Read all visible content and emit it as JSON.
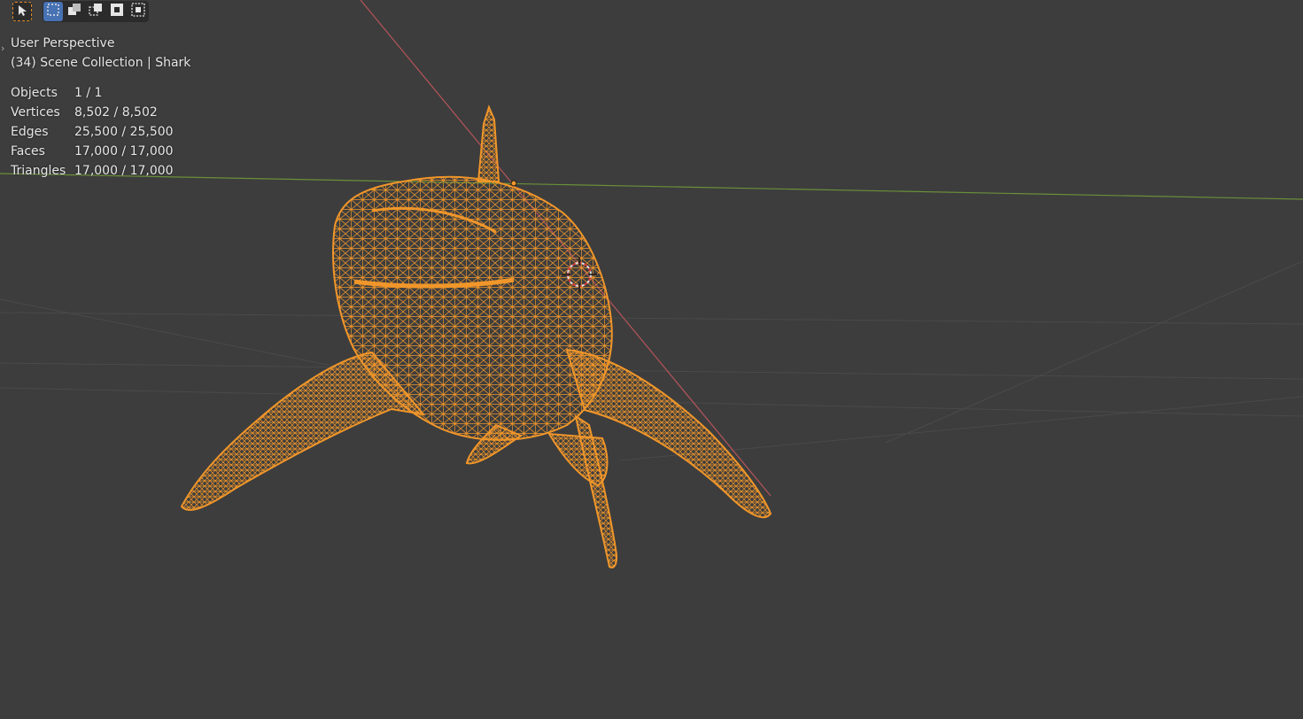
{
  "viewport": {
    "view_name": "User Perspective",
    "collection_path": "(34) Scene Collection | Shark",
    "stats": [
      {
        "label": "Objects",
        "value": "1 / 1"
      },
      {
        "label": "Vertices",
        "value": "8,502 / 8,502"
      },
      {
        "label": "Edges",
        "value": "25,500 / 25,500"
      },
      {
        "label": "Faces",
        "value": "17,000 / 17,000"
      },
      {
        "label": "Triangles",
        "value": "17,000 / 17,000"
      }
    ]
  },
  "toolbar": {
    "tool_icon": "select-cursor-icon",
    "modes": [
      {
        "icon": "select-new-icon",
        "active": true
      },
      {
        "icon": "select-extend-icon",
        "active": false
      },
      {
        "icon": "select-subtract-icon",
        "active": false
      },
      {
        "icon": "select-invert-icon",
        "active": false
      },
      {
        "icon": "select-intersect-icon",
        "active": false
      }
    ]
  },
  "colors": {
    "background": "#3d3d3d",
    "wireframe": "#f0962a",
    "x_axis": "#b5545a",
    "y_axis": "#6a8f3a",
    "active_mode": "#4772b3"
  }
}
